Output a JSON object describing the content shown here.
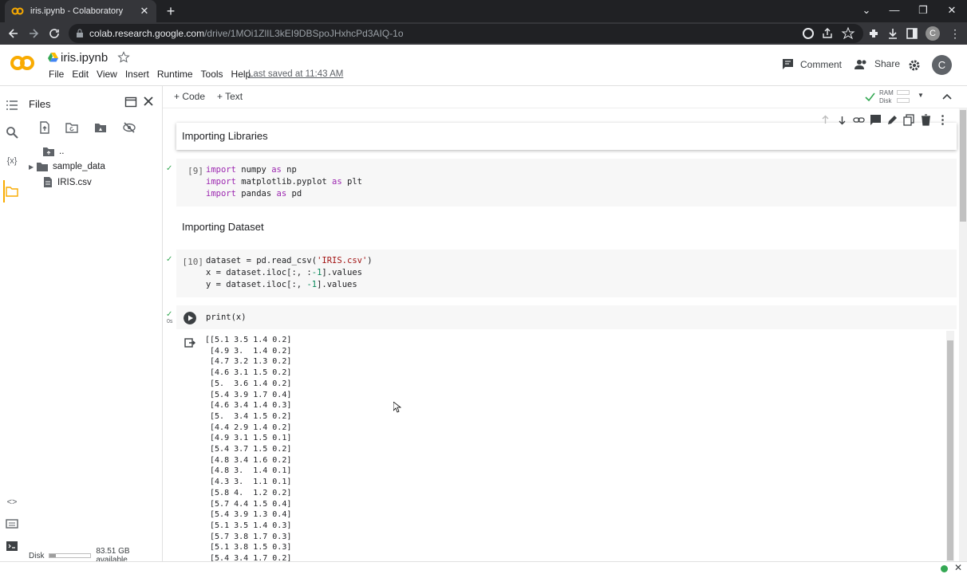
{
  "browser": {
    "tab_title": "iris.ipynb - Colaboratory",
    "url_host": "colab.research.google.com",
    "url_path": "/drive/1MOi1ZlIL3kEI9DBSpoJHxhcPd3AIQ-1o",
    "profile_initial": "C"
  },
  "header": {
    "notebook_title": "iris.ipynb",
    "menu": [
      "File",
      "Edit",
      "View",
      "Insert",
      "Runtime",
      "Tools",
      "Help"
    ],
    "last_saved": "Last saved at 11:43 AM",
    "comment_label": "Comment",
    "share_label": "Share",
    "avatar_initial": "C"
  },
  "files_panel": {
    "title": "Files",
    "items": [
      {
        "name": "..",
        "type": "folder-up"
      },
      {
        "name": "sample_data",
        "type": "folder"
      },
      {
        "name": "IRIS.csv",
        "type": "file"
      }
    ],
    "disk_label": "Disk",
    "disk_available": "83.51 GB available",
    "disk_fraction": 0.15
  },
  "toolbar": {
    "add_code": "+ Code",
    "add_text": "+ Text",
    "ram_label": "RAM",
    "disk_label": "Disk"
  },
  "cells": {
    "md1": "Importing Libraries",
    "code1": {
      "count": "[9]",
      "lines": [
        "import numpy as np",
        "import matplotlib.pyplot as plt",
        "import pandas as pd"
      ]
    },
    "md2": "Importing Dataset",
    "code2": {
      "count": "[10]",
      "lines": [
        "dataset = pd.read_csv('IRIS.csv')",
        "x = dataset.iloc[:, :-1].values",
        "y = dataset.iloc[:, -1].values"
      ]
    },
    "code3": {
      "exec_time": "0s",
      "line": "print(x)"
    },
    "output_lines": [
      "[[5.1 3.5 1.4 0.2]",
      " [4.9 3.  1.4 0.2]",
      " [4.7 3.2 1.3 0.2]",
      " [4.6 3.1 1.5 0.2]",
      " [5.  3.6 1.4 0.2]",
      " [5.4 3.9 1.7 0.4]",
      " [4.6 3.4 1.4 0.3]",
      " [5.  3.4 1.5 0.2]",
      " [4.4 2.9 1.4 0.2]",
      " [4.9 3.1 1.5 0.1]",
      " [5.4 3.7 1.5 0.2]",
      " [4.8 3.4 1.6 0.2]",
      " [4.8 3.  1.4 0.1]",
      " [4.3 3.  1.1 0.1]",
      " [5.8 4.  1.2 0.2]",
      " [5.7 4.4 1.5 0.4]",
      " [5.4 3.9 1.3 0.4]",
      " [5.1 3.5 1.4 0.3]",
      " [5.7 3.8 1.7 0.3]",
      " [5.1 3.8 1.5 0.3]",
      " [5.4 3.4 1.7 0.2]"
    ]
  }
}
